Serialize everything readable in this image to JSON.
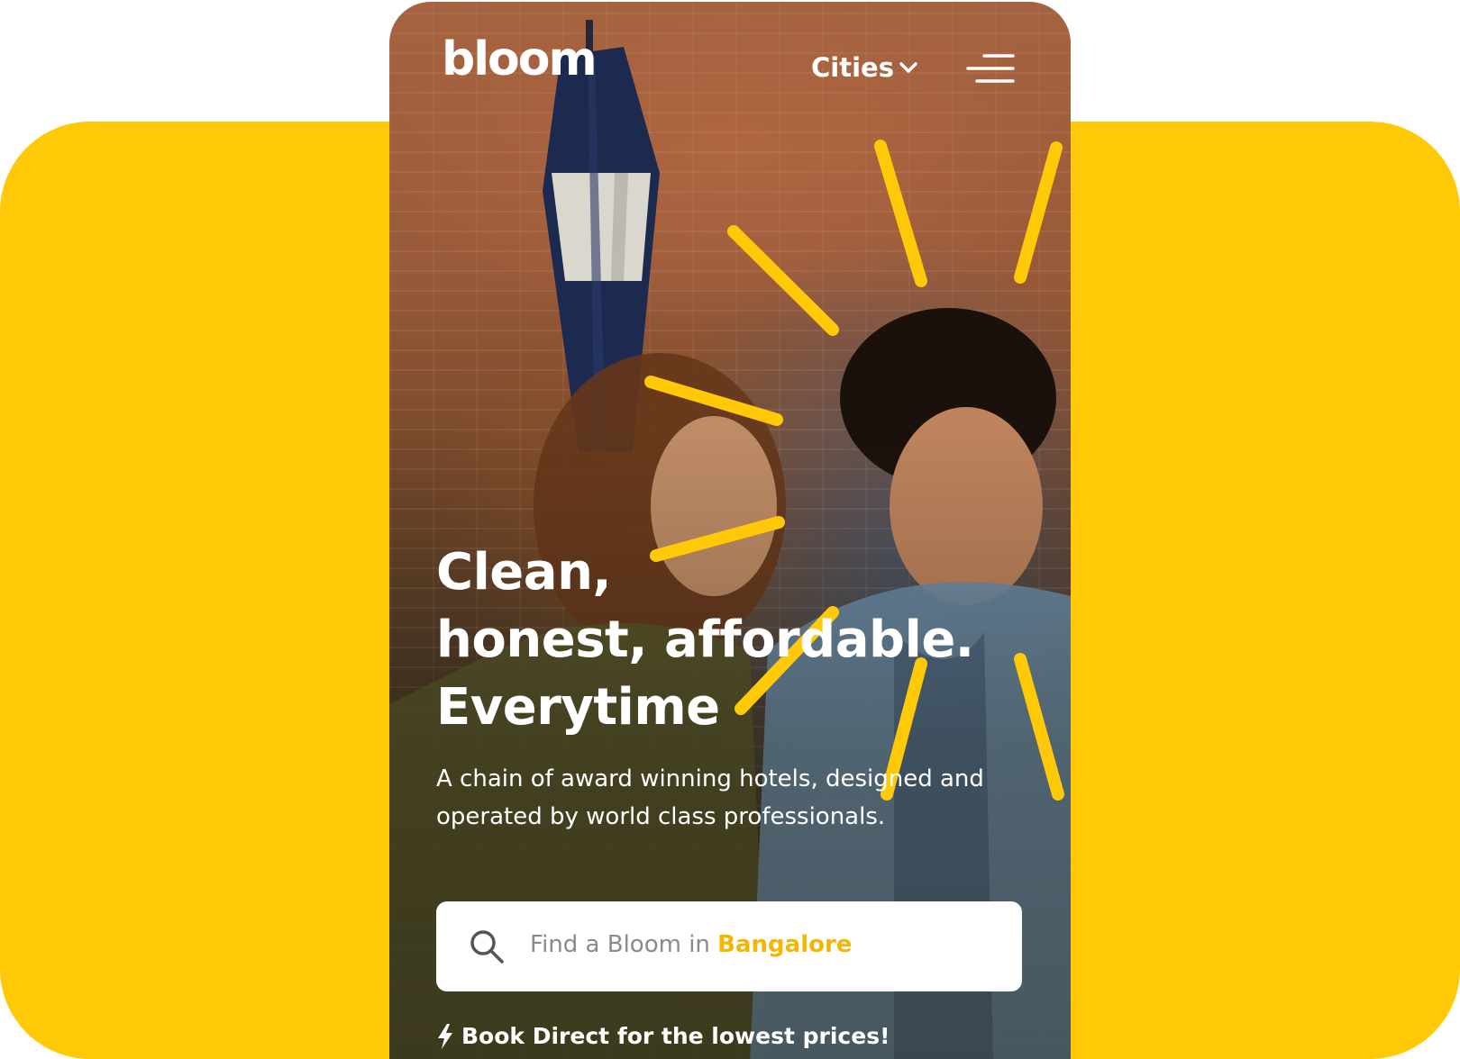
{
  "brand": {
    "logo_text": "bloom"
  },
  "nav": {
    "cities_label": "Cities",
    "cities_icon": "chevron-down-icon",
    "menu_icon": "hamburger-menu-icon"
  },
  "hero": {
    "headline_line1": "Clean,",
    "headline_line2": "honest, affordable.",
    "headline_line3": "Everytime",
    "subtext": "A chain of award winning hotels, designed and operated by world class professionals."
  },
  "search": {
    "icon": "search-icon",
    "placeholder_prefix": "Find a Bloom in ",
    "city": "Bangalore"
  },
  "promo": {
    "icon": "lightning-bolt-icon",
    "text": "Book Direct for the lowest prices!"
  },
  "colors": {
    "accent_yellow": "#FFC907",
    "city_highlight": "#F2B705",
    "text_white": "#FFFFFF",
    "placeholder_gray": "#8A8A8A"
  }
}
